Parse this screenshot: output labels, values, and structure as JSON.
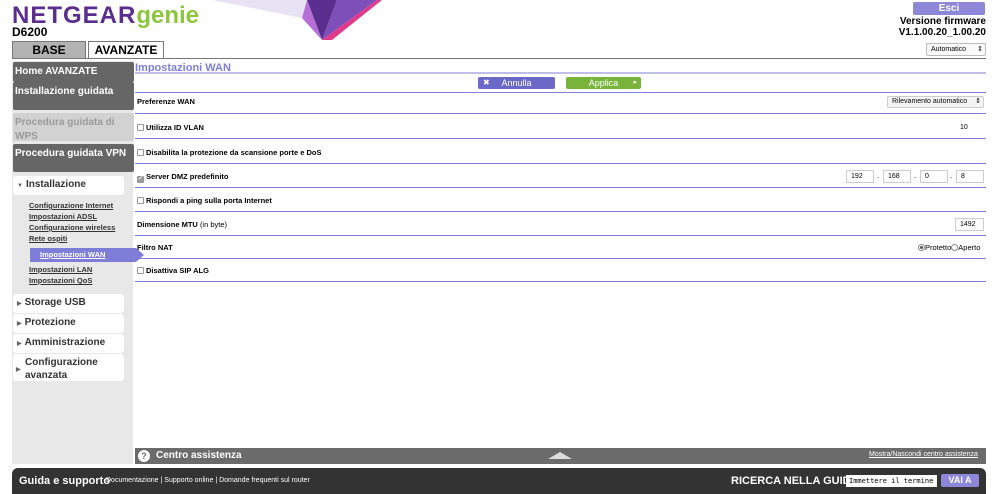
{
  "header": {
    "brand": "NETGEAR",
    "brand_suffix": "genie",
    "model": "D6200",
    "logout_label": "Esci",
    "firmware_label": "Versione firmware",
    "firmware_value": "V1.1.00.20_1.00.20",
    "tabs": [
      "BASE",
      "AVANZATE"
    ],
    "mode_select": "Automatico"
  },
  "colors": {
    "brand_purple": "#5b2d8e",
    "brand_green": "#8cc63f",
    "accent": "#7e7ed9",
    "apply_green": "#78b43c"
  },
  "sidebar": {
    "home": "Home AVANZATE",
    "wizard": "Installazione guidata",
    "wps": "Procedura guidata di WPS",
    "vpn": "Procedura guidata VPN",
    "setup": "Installazione",
    "setup_items": [
      "Configurazione Internet",
      "Impostazioni ADSL",
      "Configurazione wireless",
      "Rete ospiti",
      "Impostazioni WAN",
      "Impostazioni LAN",
      "Impostazioni QoS"
    ],
    "usb": "Storage USB",
    "security": "Protezione",
    "admin": "Amministrazione",
    "advanced": "Configurazione avanzata"
  },
  "main": {
    "title": "Impostazioni WAN",
    "cancel_label": "Annulla",
    "apply_label": "Applica",
    "wan_pref_label": "Preferenze WAN",
    "wan_pref_value": "Rilevamento automatico",
    "vlan_label": "Utilizza ID VLAN",
    "vlan_value": "10",
    "portscan_label": "Disabilita la protezione da scansione porte e DoS",
    "dmz_label": "Server DMZ predefinito",
    "dmz_ip": [
      "192",
      "168",
      "0",
      "8"
    ],
    "ping_label": "Rispondi a ping sulla porta Internet",
    "mtu_label": "Dimensione MTU",
    "mtu_unit": "(in byte)",
    "mtu_value": "1492",
    "nat_label": "Filtro NAT",
    "nat_options": [
      "Protetto",
      "Aperto"
    ],
    "sip_label": "Disattiva SIP ALG"
  },
  "help": {
    "label": "Centro assistenza",
    "toggle": "Mostra/Nascondi centro assistenza"
  },
  "footer": {
    "title": "Guida e supporto",
    "links": [
      "Documentazione",
      "Supporto online",
      "Domande frequenti sul router"
    ],
    "search_label": "RICERCA NELLA GUIDA",
    "search_placeholder": "Immettere il termine di ricerca",
    "go_label": "VAI A"
  }
}
